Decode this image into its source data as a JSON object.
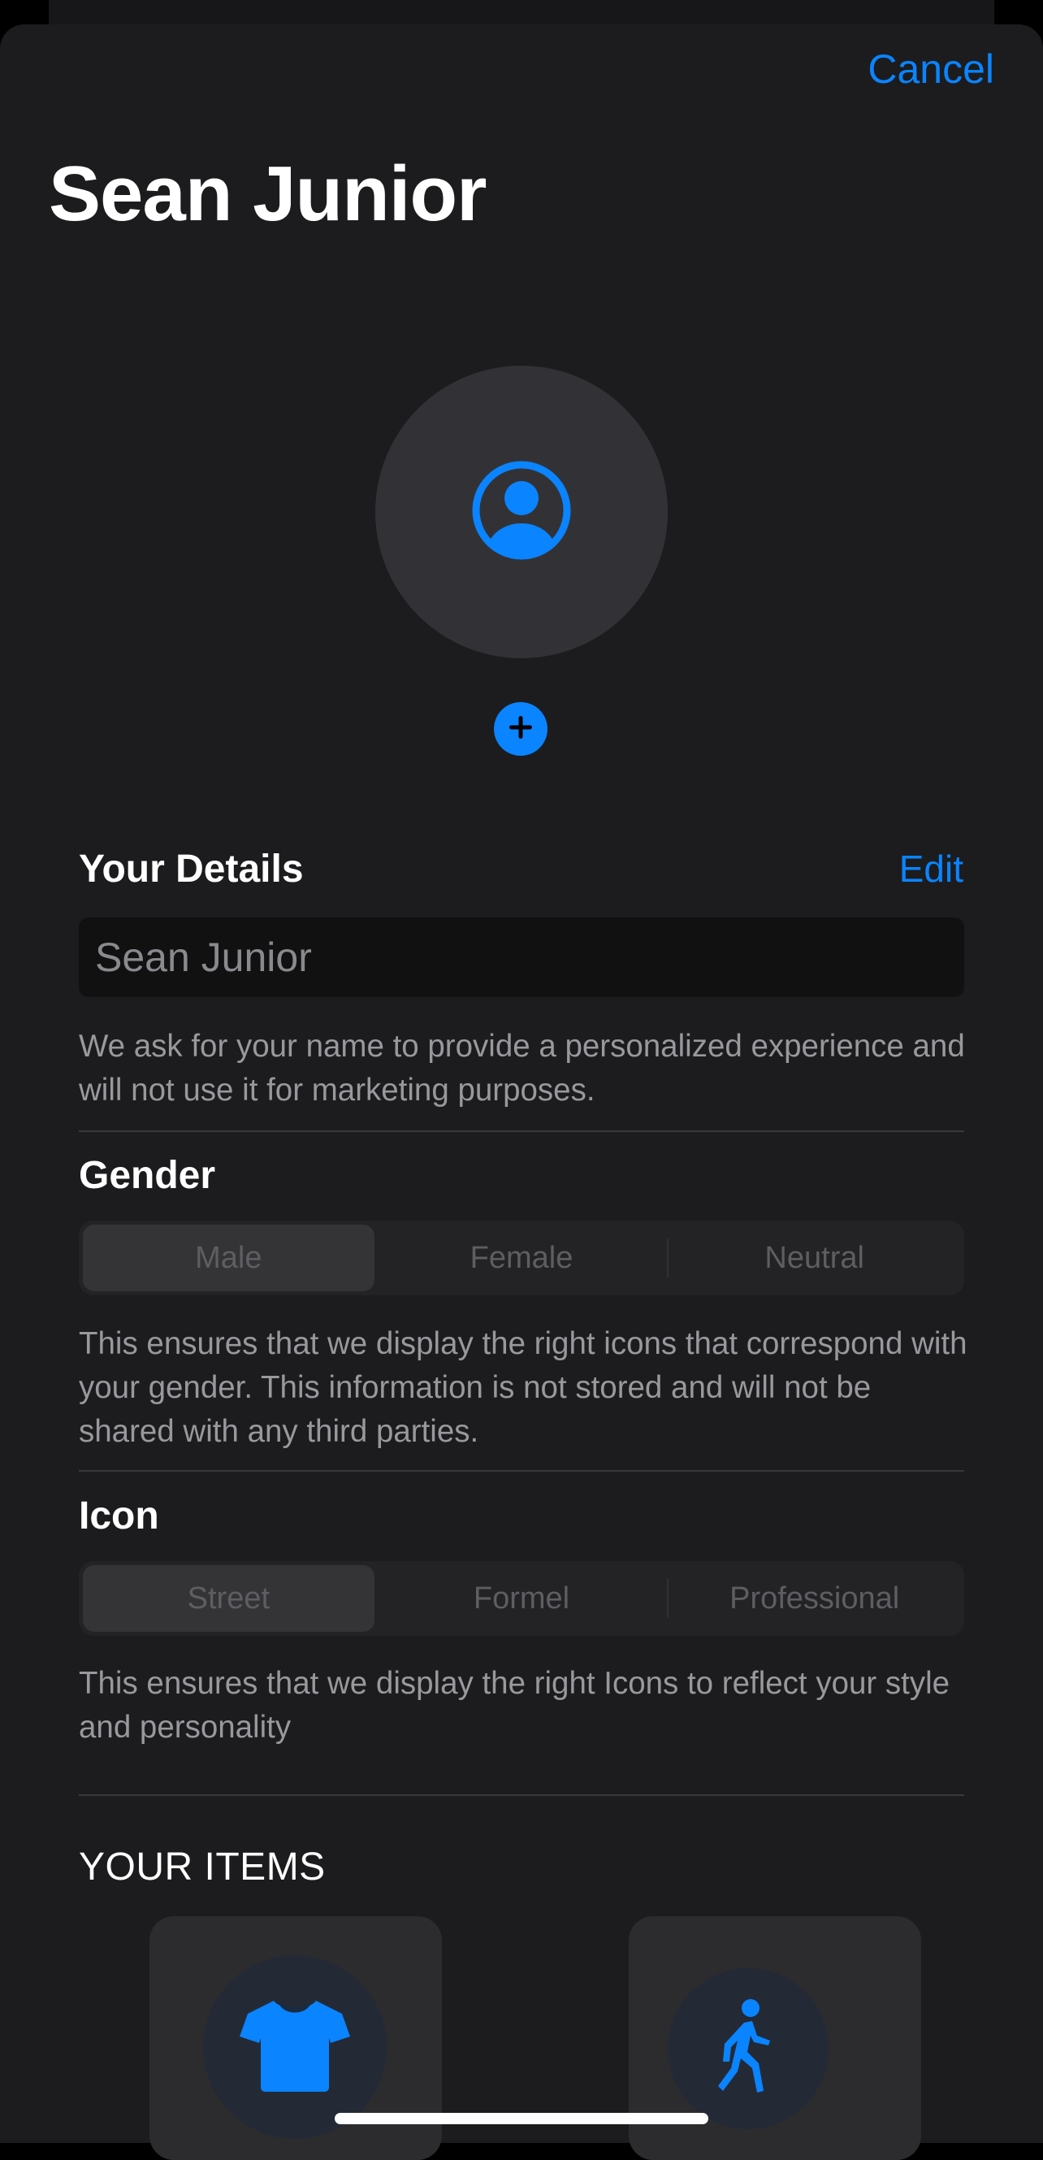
{
  "header": {
    "cancel_label": "Cancel",
    "title": "Sean Junior"
  },
  "avatar": {
    "icon": "person-circle-icon",
    "add_icon": "plus-circle-icon"
  },
  "details": {
    "heading": "Your Details",
    "edit_label": "Edit",
    "name_placeholder": "Sean Junior",
    "help_text": "We ask for your name to provide a personalized experience and will not use it for marketing purposes."
  },
  "gender": {
    "heading": "Gender",
    "options": [
      "Male",
      "Female",
      "Neutral"
    ],
    "selected": "Male",
    "help_text": "This ensures that we display the right icons that correspond with your gender. This information is not stored and will not be shared with any third parties."
  },
  "icon_style": {
    "heading": "Icon",
    "options": [
      "Street",
      "Formel",
      "Professional"
    ],
    "selected": "Street",
    "help_text": "This ensures that we display the right Icons to reflect your style and personality"
  },
  "items": {
    "heading": "YOUR ITEMS",
    "cards": [
      {
        "icon": "tshirt-icon"
      },
      {
        "icon": "walking-person-icon"
      }
    ]
  },
  "colors": {
    "accent": "#0a84ff",
    "background": "#1c1c1e",
    "text": "#ffffff",
    "secondary_text": "#98989d"
  }
}
